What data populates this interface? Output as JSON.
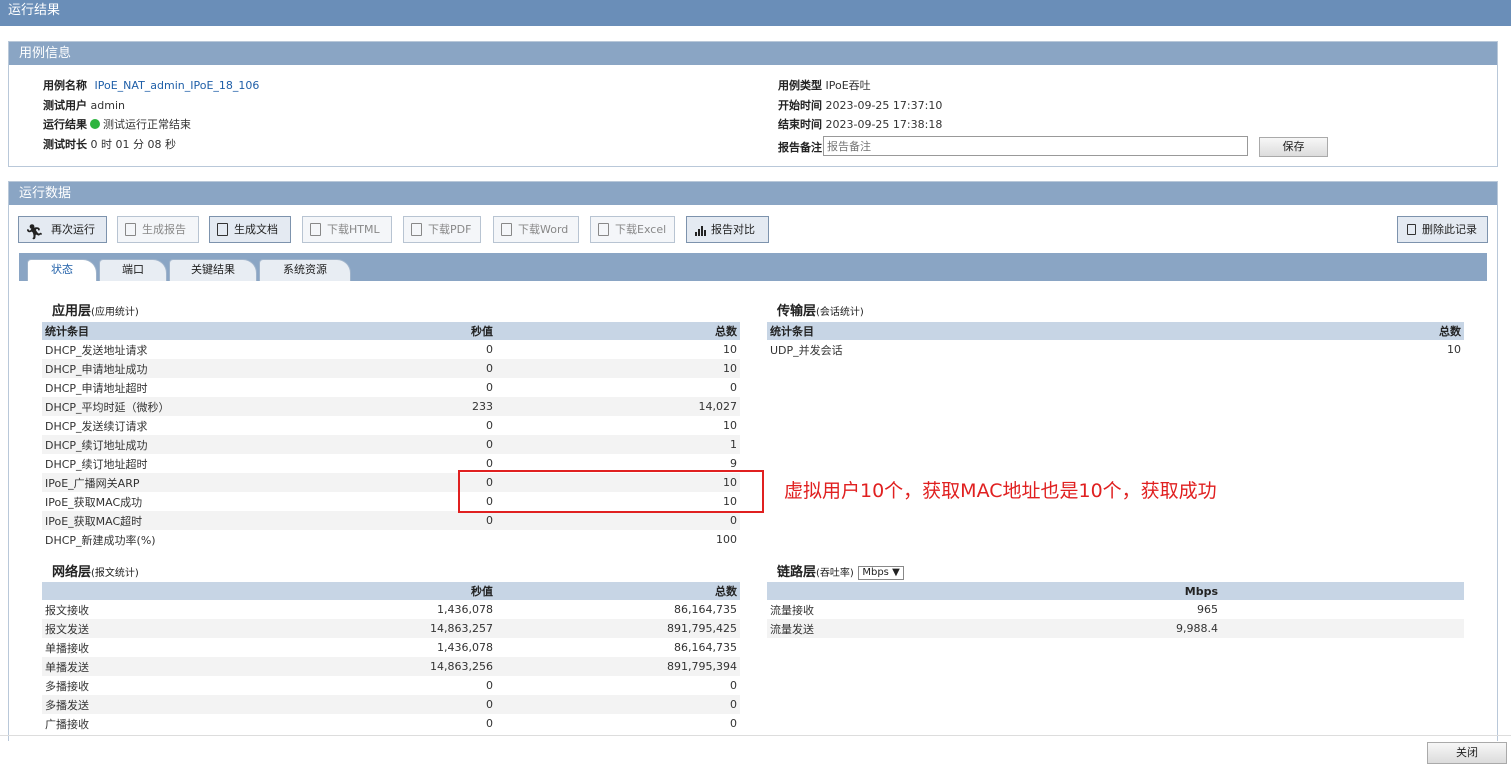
{
  "window_title": "运行结果",
  "info": {
    "header": "用例信息",
    "name_label": "用例名称",
    "name_value": "IPoE_NAT_admin_IPoE_18_106",
    "user_label": "测试用户",
    "user_value": "admin",
    "result_label": "运行结果",
    "result_value": "测试运行正常结束",
    "duration_label": "测试时长",
    "duration_value": "0 时 01 分 08 秒",
    "type_label": "用例类型",
    "type_value": "IPoE吞吐",
    "start_label": "开始时间",
    "start_value": "2023-09-25 17:37:10",
    "end_label": "结束时间",
    "end_value": "2023-09-25 17:38:18",
    "remark_label": "报告备注",
    "remark_placeholder": "报告备注",
    "save_label": "保存",
    "status_color": "#2db43f"
  },
  "data_panel": {
    "header": "运行数据",
    "toolbar": {
      "rerun": "再次运行",
      "gen_report": "生成报告",
      "gen_doc": "生成文档",
      "dl_html": "下载HTML",
      "dl_pdf": "下载PDF",
      "dl_word": "下载Word",
      "dl_excel": "下载Excel",
      "compare": "报告对比",
      "delete": "删除此记录"
    },
    "tabs": [
      "状态",
      "端口",
      "关键结果",
      "系统资源"
    ],
    "app_layer": {
      "title": "应用层",
      "subtitle": "(应用统计)",
      "headers": [
        "统计条目",
        "秒值",
        "总数"
      ],
      "rows": [
        [
          "DHCP_发送地址请求",
          "0",
          "10"
        ],
        [
          "DHCP_申请地址成功",
          "0",
          "10"
        ],
        [
          "DHCP_申请地址超时",
          "0",
          "0"
        ],
        [
          "DHCP_平均时延（微秒）",
          "233",
          "14,027"
        ],
        [
          "DHCP_发送续订请求",
          "0",
          "10"
        ],
        [
          "DHCP_续订地址成功",
          "0",
          "1"
        ],
        [
          "DHCP_续订地址超时",
          "0",
          "9"
        ],
        [
          "IPoE_广播网关ARP",
          "0",
          "10"
        ],
        [
          "IPoE_获取MAC成功",
          "0",
          "10"
        ],
        [
          "IPoE_获取MAC超时",
          "0",
          "0"
        ],
        [
          "DHCP_新建成功率(%)",
          "",
          "100"
        ]
      ]
    },
    "transport_layer": {
      "title": "传输层",
      "subtitle": "(会话统计)",
      "headers": [
        "统计条目",
        "总数"
      ],
      "rows": [
        [
          "UDP_并发会话",
          "10"
        ]
      ]
    },
    "net_layer": {
      "title": "网络层",
      "subtitle": "(报文统计)",
      "headers": [
        "",
        "秒值",
        "总数"
      ],
      "rows": [
        [
          "报文接收",
          "1,436,078",
          "86,164,735"
        ],
        [
          "报文发送",
          "14,863,257",
          "891,795,425"
        ],
        [
          "单播接收",
          "1,436,078",
          "86,164,735"
        ],
        [
          "单播发送",
          "14,863,256",
          "891,795,394"
        ],
        [
          "多播接收",
          "0",
          "0"
        ],
        [
          "多播发送",
          "0",
          "0"
        ],
        [
          "广播接收",
          "0",
          "0"
        ]
      ]
    },
    "link_layer": {
      "title": "链路层",
      "subtitle": "(吞吐率)",
      "unit_select": "Mbps",
      "headers": [
        "",
        "Mbps"
      ],
      "rows": [
        [
          "流量接收",
          "965"
        ],
        [
          "流量发送",
          "9,988.4"
        ]
      ]
    }
  },
  "annotation": "虚拟用户10个，获取MAC地址也是10个，获取成功",
  "close_label": "关闭",
  "colors": {
    "titlebar": "#6a8eb8",
    "panel_header": "#8aa5c4",
    "table_header": "#c7d5e5",
    "annotation": "#e02020"
  }
}
